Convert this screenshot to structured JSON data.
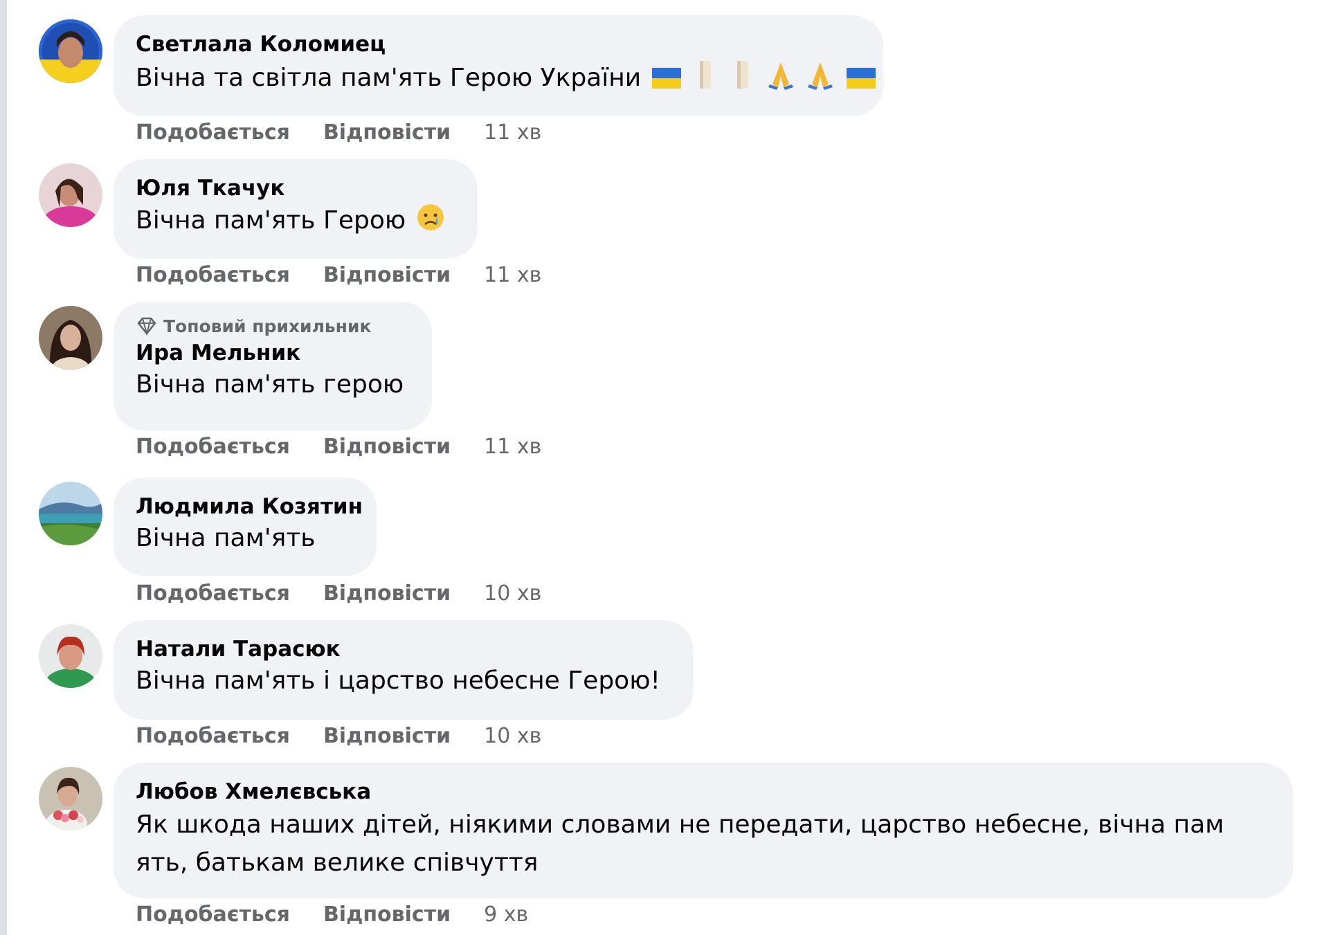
{
  "comments": [
    {
      "author": "Светлала Коломиец",
      "text": "Вічна та світла пам'ять Герою України",
      "time": "11 хв",
      "emojis": [
        "flag-ua-icon",
        "candle-icon",
        "candle-icon",
        "pray-icon",
        "pray-icon",
        "flag-ua-icon"
      ]
    },
    {
      "author": "Юля Ткачук",
      "text": "Вічна пам'ять Герою",
      "time": "11 хв",
      "emojis": [
        "crying-face-icon"
      ]
    },
    {
      "badge": "Топовий прихильник",
      "author": "Ира Мельник",
      "text": "Вічна пам'ять герою",
      "time": "11 хв"
    },
    {
      "author": "Людмила Козятин",
      "text": "Вічна пам'ять",
      "time": "10 хв"
    },
    {
      "author": "Натали Тарасюк",
      "text": "Вічна пам'ять і царство небесне Герою!",
      "time": "10 хв"
    },
    {
      "author": "Любов Хмелєвська",
      "text": "Як шкода наших дітей, ніякими словами не передати, царство небесне, вічна пам ять, батькам велике співчуття",
      "time": "9 хв"
    }
  ],
  "actions": {
    "like": "Подобається",
    "reply": "Відповісти"
  },
  "colors": {
    "bubble": "#f0f2f5",
    "secondary_text": "#65676b",
    "primary_text": "#050505"
  }
}
